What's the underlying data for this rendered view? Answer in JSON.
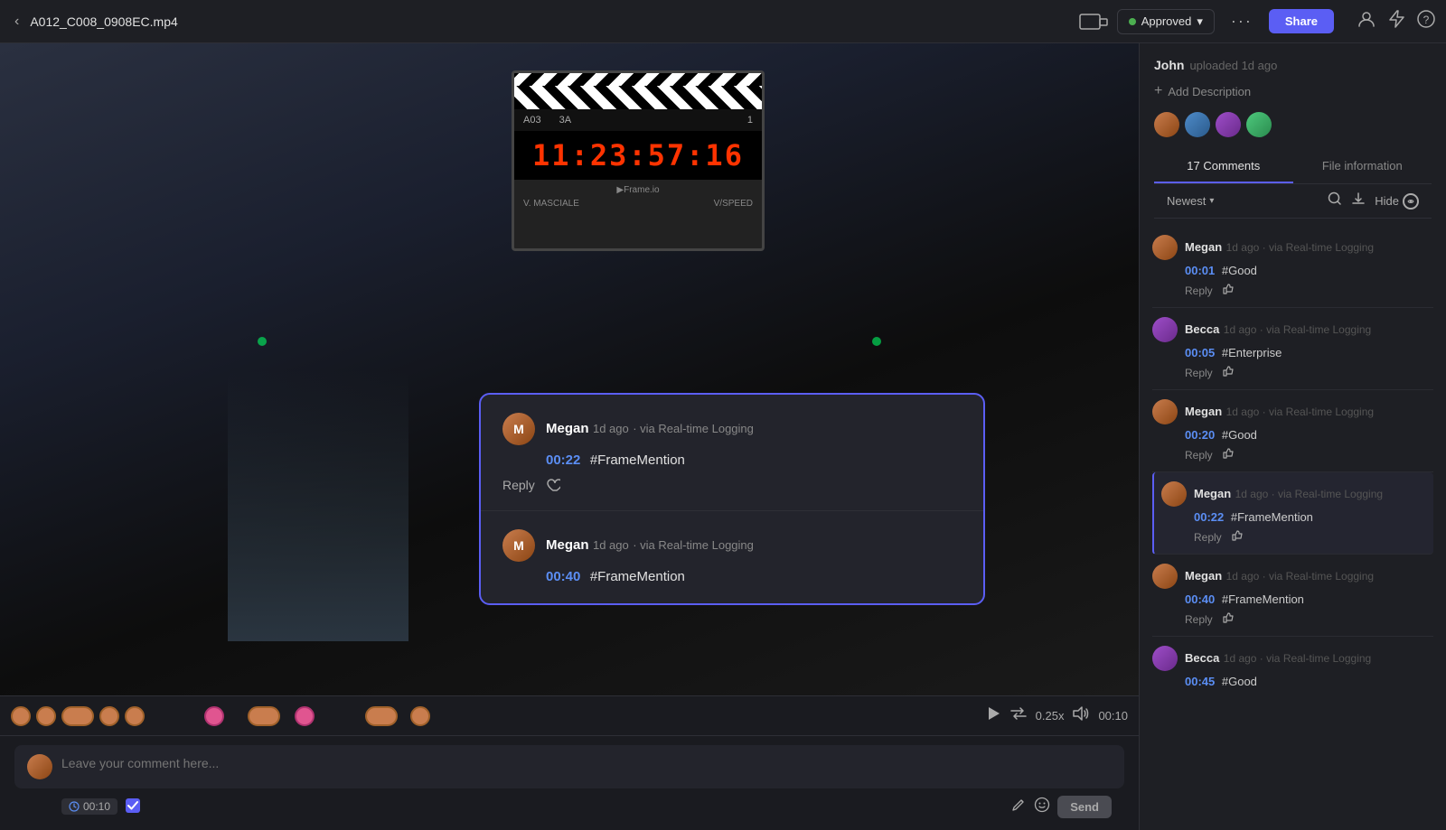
{
  "topbar": {
    "back_icon": "‹",
    "filename": "A012_C008_0908EC.mp4",
    "device_icon": "⬜",
    "status_label": "Approved",
    "status_dot_color": "#4caf50",
    "chevron": "▾",
    "more_icon": "···",
    "share_label": "Share",
    "user_icon": "👤",
    "bolt_icon": "⚡",
    "help_icon": "?"
  },
  "sidebar": {
    "uploader_name": "John",
    "upload_meta": "uploaded 1d ago",
    "add_description": "Add Description",
    "tabs": [
      {
        "id": "comments",
        "label": "17 Comments",
        "active": true
      },
      {
        "id": "file_info",
        "label": "File information",
        "active": false
      }
    ],
    "sort_label": "Newest",
    "sort_chevron": "▾",
    "hide_label": "Hide",
    "comments": [
      {
        "id": 1,
        "user": "Megan",
        "time": "1d ago",
        "via": "via Real-time Logging",
        "timecode": "00:01",
        "text": "#Good",
        "avatar_class": "megan"
      },
      {
        "id": 2,
        "user": "Becca",
        "time": "1d ago",
        "via": "via Real-time Logging",
        "timecode": "00:05",
        "text": "#Enterprise",
        "avatar_class": "becca"
      },
      {
        "id": 3,
        "user": "Megan",
        "time": "1d ago",
        "via": "via Real-time Logging",
        "timecode": "00:20",
        "text": "#Good",
        "avatar_class": "megan"
      },
      {
        "id": 4,
        "user": "Megan",
        "time": "1d ago",
        "via": "via Real-time Logging",
        "timecode": "00:22",
        "text": "#FrameMention",
        "avatar_class": "megan"
      },
      {
        "id": 5,
        "user": "Megan",
        "time": "1d ago",
        "via": "via Real-time Logging",
        "timecode": "00:40",
        "text": "#FrameMention",
        "avatar_class": "megan"
      },
      {
        "id": 6,
        "user": "Becca",
        "time": "1d ago",
        "via": "via Real-time Logging",
        "timecode": "00:45",
        "text": "#Good",
        "avatar_class": "becca"
      }
    ]
  },
  "video": {
    "timecode_display": "11:23:57:16",
    "current_time": "00:10",
    "total_time": "/",
    "speed": "0.25x",
    "tracking_label": "Frame.io"
  },
  "popup": {
    "comments": [
      {
        "id": 1,
        "user": "Megan",
        "time": "1d ago",
        "via": "via Real-time Logging",
        "timecode": "00:22",
        "text": "#FrameMention",
        "reply_label": "Reply",
        "like_icon": "👍"
      },
      {
        "id": 2,
        "user": "Megan",
        "time": "1d ago",
        "via": "via Real-time Logging",
        "timecode": "00:40",
        "text": "#FrameMention"
      }
    ]
  },
  "comment_input": {
    "placeholder": "Leave your comment here...",
    "timecode": "00:10",
    "send_label": "Send"
  }
}
